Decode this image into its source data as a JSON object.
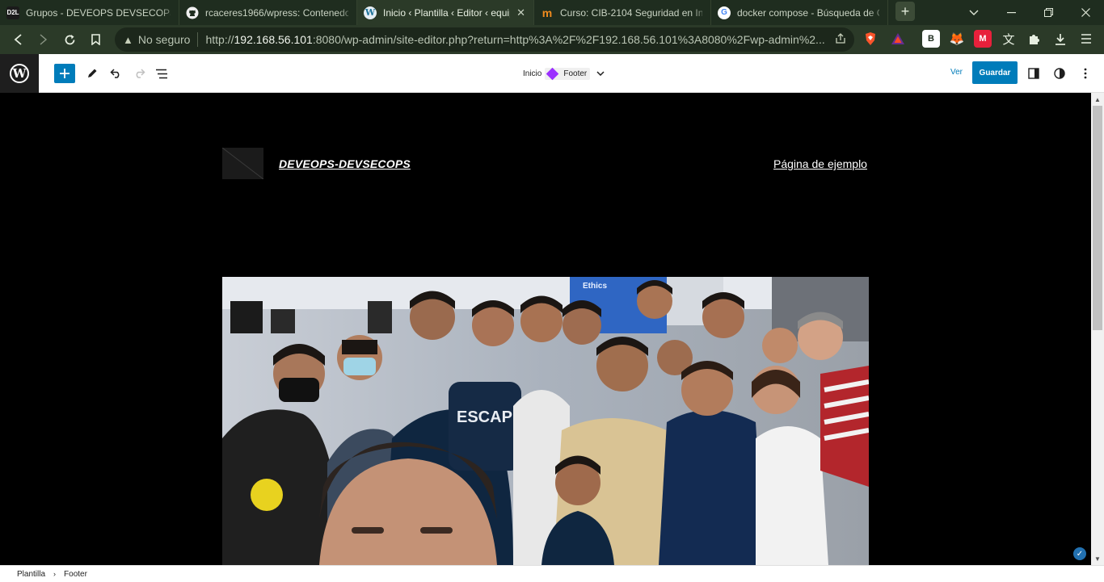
{
  "browser": {
    "tabs": [
      {
        "title": "Grupos - DEVEOPS DEVSECOPS - ",
        "favicon_text": "D2L",
        "favicon_color": "#1b1b1b"
      },
      {
        "title": "rcaceres1966/wpress: Contenedor",
        "favicon_text": "",
        "favicon_color": "#f0f0f0"
      },
      {
        "title": "Inicio ‹ Plantilla ‹ Editor ‹ equip",
        "favicon_text": "W",
        "favicon_color": "#e6eef5",
        "active": true
      },
      {
        "title": "Curso: CIB-2104 Seguridad en Infr",
        "favicon_text": "m",
        "favicon_color": "#f28c1e"
      },
      {
        "title": "docker compose - Búsqueda de G",
        "favicon_text": "G",
        "favicon_color": "#ffffff"
      }
    ],
    "new_tab": "+",
    "address": {
      "security_label": "No seguro",
      "url_prefix": "http://",
      "url_host": "192.168.56.101",
      "url_rest": ":8080/wp-admin/site-editor.php?return=http%3A%2F%2F192.168.56.101%3A8080%2Fwp-admin%2..."
    }
  },
  "editor": {
    "breadcrumb_top": {
      "home": "Inicio",
      "template": "Footer"
    },
    "view_label": "Ver",
    "save_label": "Guardar"
  },
  "site": {
    "title": "DEVEOPS-DEVSECOPS",
    "nav_item": "Página de ejemplo"
  },
  "footer_breadcrumb": {
    "root": "Plantilla",
    "current": "Footer"
  },
  "colors": {
    "wp_blue": "#007cba",
    "template_purple": "#9b30ff"
  }
}
